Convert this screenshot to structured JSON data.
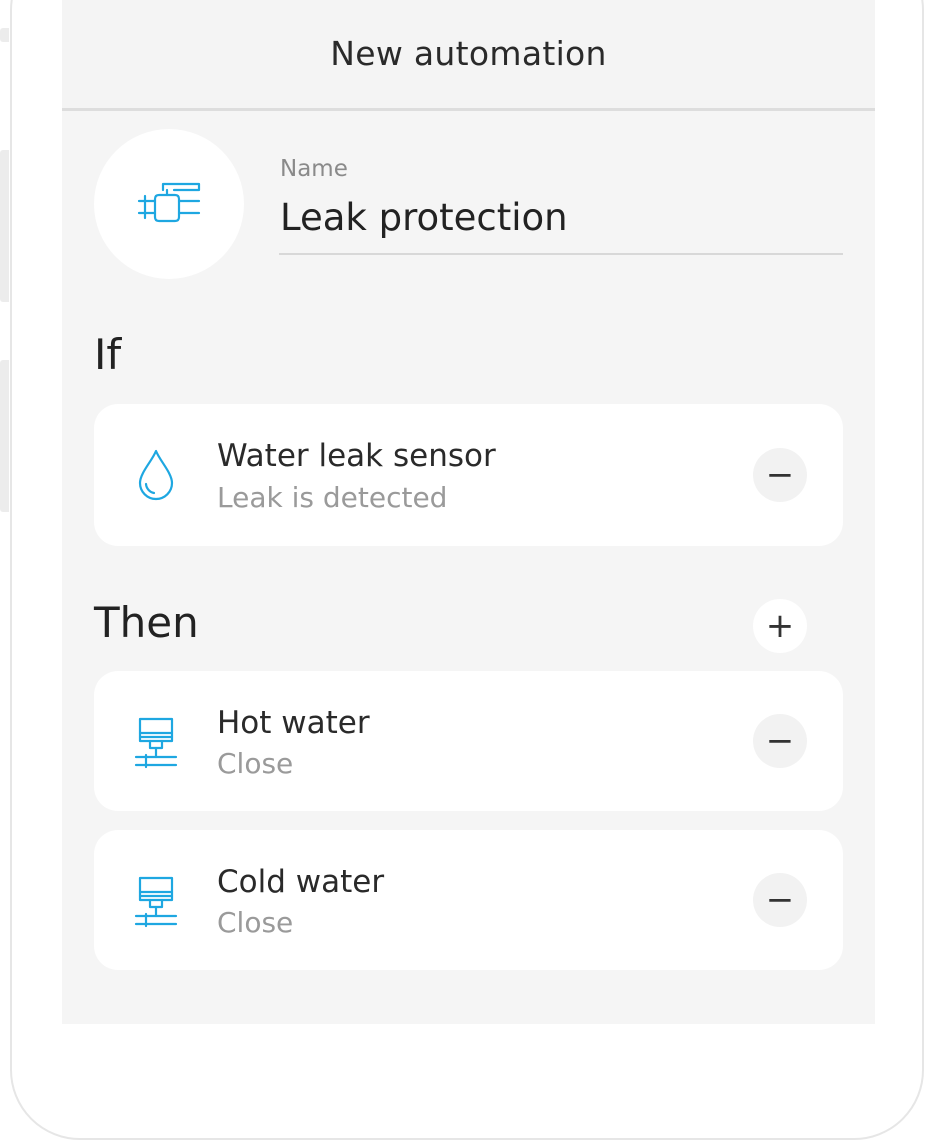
{
  "header": {
    "title": "New automation"
  },
  "automation": {
    "icon": "valve-icon",
    "name_label": "Name",
    "name_value": "Leak protection"
  },
  "if_section": {
    "title": "If",
    "conditions": [
      {
        "icon": "water-drop-icon",
        "title": "Water leak  sensor",
        "subtitle": "Leak is detected",
        "remove_symbol": "−"
      }
    ]
  },
  "then_section": {
    "title": "Then",
    "add_symbol": "+",
    "actions": [
      {
        "icon": "valve-actuator-icon",
        "title": "Hot water",
        "subtitle": "Close",
        "remove_symbol": "−"
      },
      {
        "icon": "valve-actuator-icon",
        "title": "Cold water",
        "subtitle": "Close",
        "remove_symbol": "−"
      }
    ]
  },
  "colors": {
    "accent": "#1ea7e1",
    "background": "#f5f5f5",
    "card": "#ffffff",
    "secondary_text": "#9a9a9a"
  }
}
